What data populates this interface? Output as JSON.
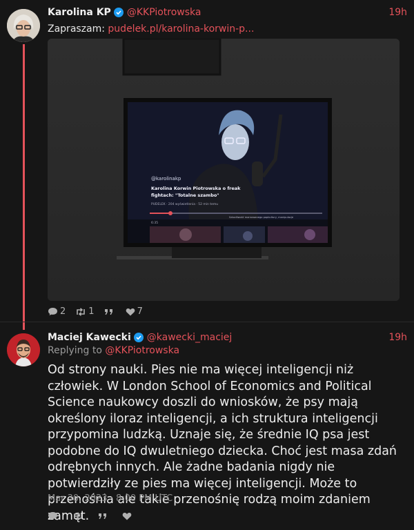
{
  "tweets": [
    {
      "fullname": "Karolina KP",
      "handle": "@KKPiotrowska",
      "time": "19h",
      "text_prefix": "Zapraszam: ",
      "link": "pudelek.pl/karolina-korwin-p...",
      "stats": {
        "replies": "2",
        "retweets": "1",
        "quotes": "",
        "likes": "7"
      },
      "media": {
        "tv_handle": "@karolinakp",
        "tv_title_line1": "Karolina Korwin Piotrowska o freak",
        "tv_title_line2": "fightach: \"Totalne szambo\"",
        "tv_meta": "PUDELEK · 204 wyświetlenia · 52 min temu",
        "tv_time": "6:35",
        "tv_desc": "Szkodliwość marnowanego popkultury, manipulacje",
        "progress": 0.12
      }
    },
    {
      "fullname": "Maciej Kawecki",
      "handle": "@kawecki_maciej",
      "time": "19h",
      "replying_prefix": "Replying to ",
      "replying_to": "@KKPiotrowska",
      "body": "Od strony nauki. Pies nie ma więcej inteligencji niż człowiek. W London School of Economics and Political Science naukowcy doszli do wniosków, że psy mają określony iloraz inteligencji, a ich struktura inteligencji przypomina ludzką. Uznaje się, że średnie IQ psa jest podobne do IQ dwuletniego dziecka. Choć jest masa zdań odrębnych innych. Ale żadne badania nigdy nie potwierdziły ze pies ma więcej inteligencji. Może to przenośnia ale takie przenośnię rodzą moim zdaniem zamęt.",
      "date": "Mar 30, 2023 · 8:00 PM UTC"
    }
  ],
  "colors": {
    "accent": "#e4525a",
    "verified": "#1d9bf0",
    "background": "#161616"
  }
}
